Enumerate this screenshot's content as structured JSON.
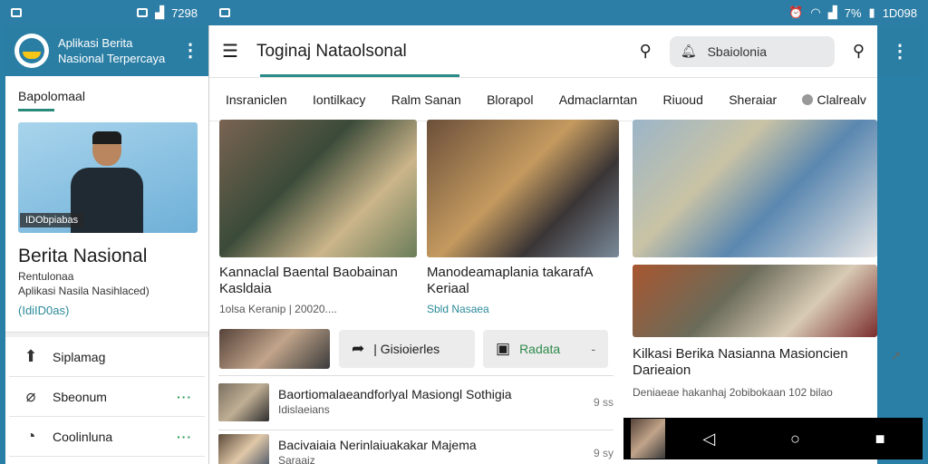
{
  "status_left": {
    "time": "7298"
  },
  "status_right": {
    "battery": "7%",
    "time": "1D098"
  },
  "app": {
    "title_line1": "Aplikasi Berita",
    "title_line2": "Nasional Terpercaya"
  },
  "left": {
    "section_title": "Bapolomaal",
    "image_badge": "IDObpiabas",
    "profile_name": "Berita Nasional",
    "profile_sub1": "Rentulonaa",
    "profile_sub2": "Aplikasi Nasila Nasihlaced)",
    "profile_link": "(IdiID0as)",
    "menu": [
      {
        "label": "Siplamag",
        "icon": "⬆"
      },
      {
        "label": "Sbeonum",
        "icon": "⌀"
      },
      {
        "label": "Coolinluna",
        "icon": "◔"
      }
    ]
  },
  "main": {
    "title": "Toginaj Nataolsonal",
    "search_placeholder": "Sbaiolonia",
    "tabs": [
      "Insraniclen",
      "Iontilkacy",
      "Ralm Sanan",
      "Blorapol",
      "Admaclarntan",
      "Riuoud",
      "Sheraiar",
      "Clalrealv"
    ],
    "card1": {
      "title": "Kannaclal Baental Baobainan Kasldaia",
      "meta": "1olsa Keranip | 20020...."
    },
    "card2": {
      "title": "Manodeamaplania takarafA Keriaal",
      "meta": "Sbld Nasaea"
    },
    "card4": {
      "title": "Kilkasi Berika Nasianna Masioncien Darieaion",
      "meta": "Deniaeae hakanhaj 2obibokaan 102 bilao"
    },
    "pill1": "| Gisioierles",
    "pill2": "Radata",
    "pill2_extra": "-",
    "list": [
      {
        "title": "Baortiomalaeandforlyal Masiongl Sothigia",
        "sub": "Idislaeians",
        "time": "9 ss"
      },
      {
        "title": "Bacivaiaia Nerinlaiuakakar Majema",
        "sub": "Saraaiz",
        "time": "9 sy"
      }
    ]
  },
  "colors": {
    "brand": "#2a7ea4",
    "accent": "#2a8a8a"
  }
}
